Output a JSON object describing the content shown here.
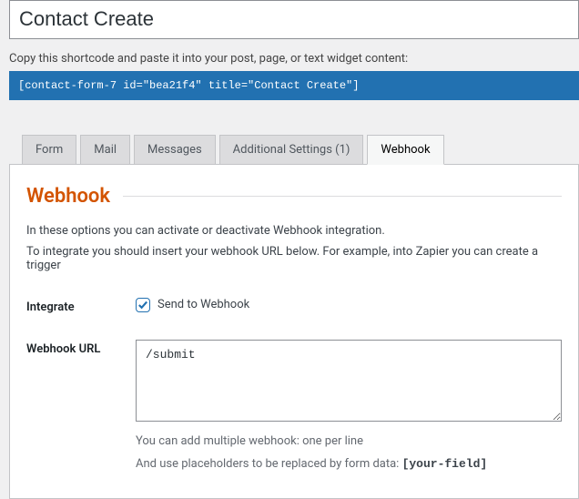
{
  "form_title": "Contact Create",
  "shortcode_label": "Copy this shortcode and paste it into your post, page, or text widget content:",
  "shortcode": "[contact-form-7 id=\"bea21f4\" title=\"Contact Create\"]",
  "tabs": [
    {
      "label": "Form"
    },
    {
      "label": "Mail"
    },
    {
      "label": "Messages"
    },
    {
      "label": "Additional Settings (1)"
    },
    {
      "label": "Webhook"
    }
  ],
  "panel": {
    "title": "Webhook",
    "desc1": "In these options you can activate or deactivate Webhook integration.",
    "desc2": "To integrate you should insert your webhook URL below. For example, into Zapier you can create a trigger",
    "integrate_label": "Integrate",
    "send_to_webhook_label": "Send to Webhook",
    "url_label": "Webhook URL",
    "url_value": "/submit",
    "helper1": "You can add multiple webhook: one per line",
    "helper2_prefix": "And use placeholders to be replaced by form data: ",
    "helper2_code": "[your-field]"
  }
}
